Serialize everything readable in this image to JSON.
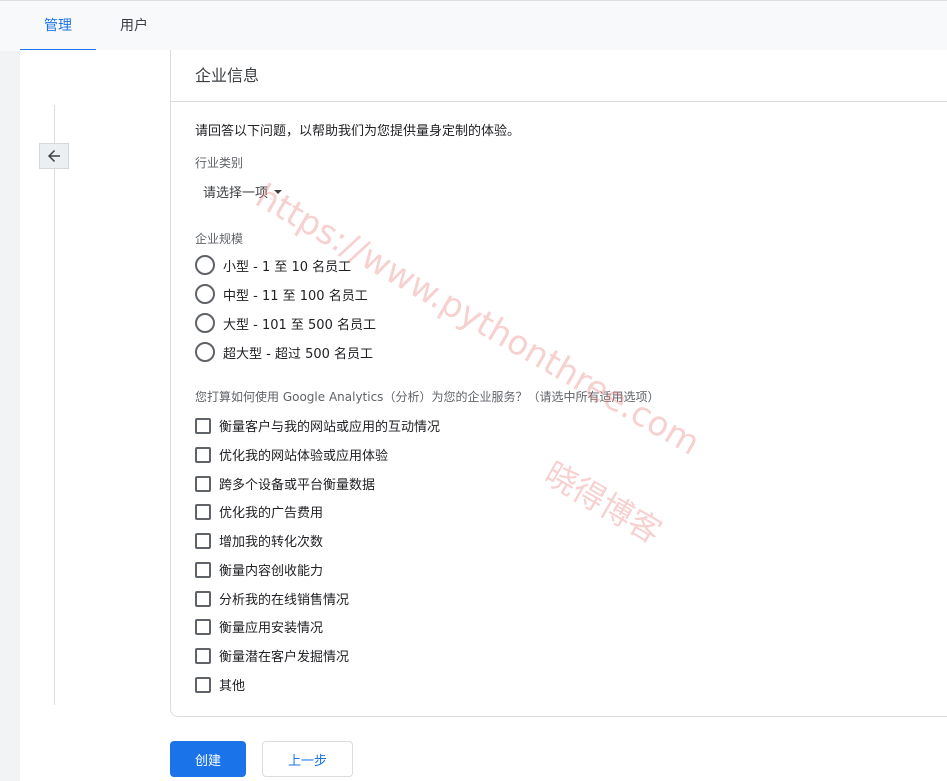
{
  "tabs": [
    {
      "label": "管理",
      "active": true
    },
    {
      "label": "用户",
      "active": false
    }
  ],
  "card": {
    "title": "企业信息",
    "intro": "请回答以下问题，以帮助我们为您提供量身定制的体验。"
  },
  "industry": {
    "label": "行业类别",
    "value": "请选择一项"
  },
  "size": {
    "label": "企业规模",
    "options": [
      "小型 - 1 至 10 名员工",
      "中型 - 11 至 100 名员工",
      "大型 - 101 至 500 名员工",
      "超大型 - 超过 500 名员工"
    ]
  },
  "usage": {
    "label": "您打算如何使用 Google Analytics（分析）为您的企业服务？（请选中所有适用选项）",
    "options": [
      "衡量客户与我的网站或应用的互动情况",
      "优化我的网站体验或应用体验",
      "跨多个设备或平台衡量数据",
      "优化我的广告费用",
      "增加我的转化次数",
      "衡量内容创收能力",
      "分析我的在线销售情况",
      "衡量应用安装情况",
      "衡量潜在客户发掘情况",
      "其他"
    ]
  },
  "buttons": {
    "create": "创建",
    "back": "上一步"
  },
  "watermark": {
    "line1": "https://www.pythonthree.com",
    "line2": "晓得博客"
  },
  "colors": {
    "accent": "#1a73e8",
    "watermark": "#e97878"
  }
}
